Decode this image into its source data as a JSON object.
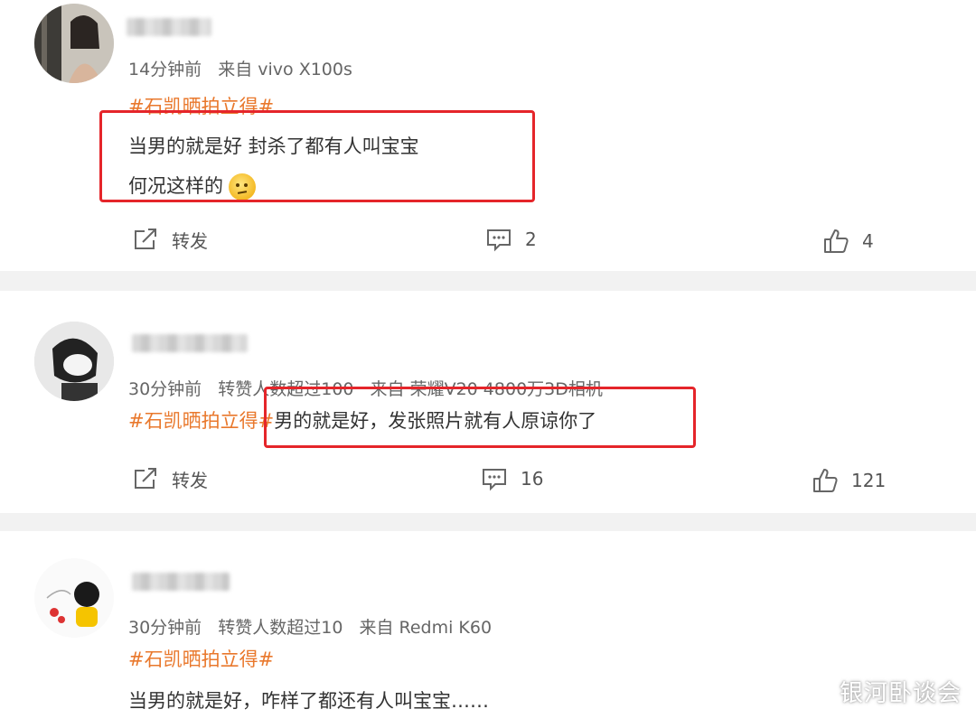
{
  "posts": [
    {
      "time": "14分钟前",
      "extra": "",
      "source": "来自 vivo X100s",
      "hashtag": "#石凯晒拍立得#",
      "lines": [
        "当男的就是好 封杀了都有人叫宝宝",
        "何况这样的"
      ],
      "repost_label": "转发",
      "comment_count": "2",
      "like_count": "4"
    },
    {
      "time": "30分钟前",
      "extra": "转赞人数超过100",
      "source": "来自 荣耀V20 4800万3D相机",
      "hashtag": "#石凯晒拍立得#",
      "text": "男的就是好，发张照片就有人原谅你了",
      "repost_label": "转发",
      "comment_count": "16",
      "like_count": "121"
    },
    {
      "time": "30分钟前",
      "extra": "转赞人数超过10",
      "source": "来自 Redmi K60",
      "hashtag": "#石凯晒拍立得#",
      "text": "当男的就是好，咋样了都还有人叫宝宝……"
    }
  ],
  "watermark": "银河卧谈会",
  "colors": {
    "tag": "#e9782c",
    "highlight_box": "#e5252a"
  },
  "icons": {
    "repost": "repost-icon",
    "comment": "comment-icon",
    "like": "like-icon"
  }
}
